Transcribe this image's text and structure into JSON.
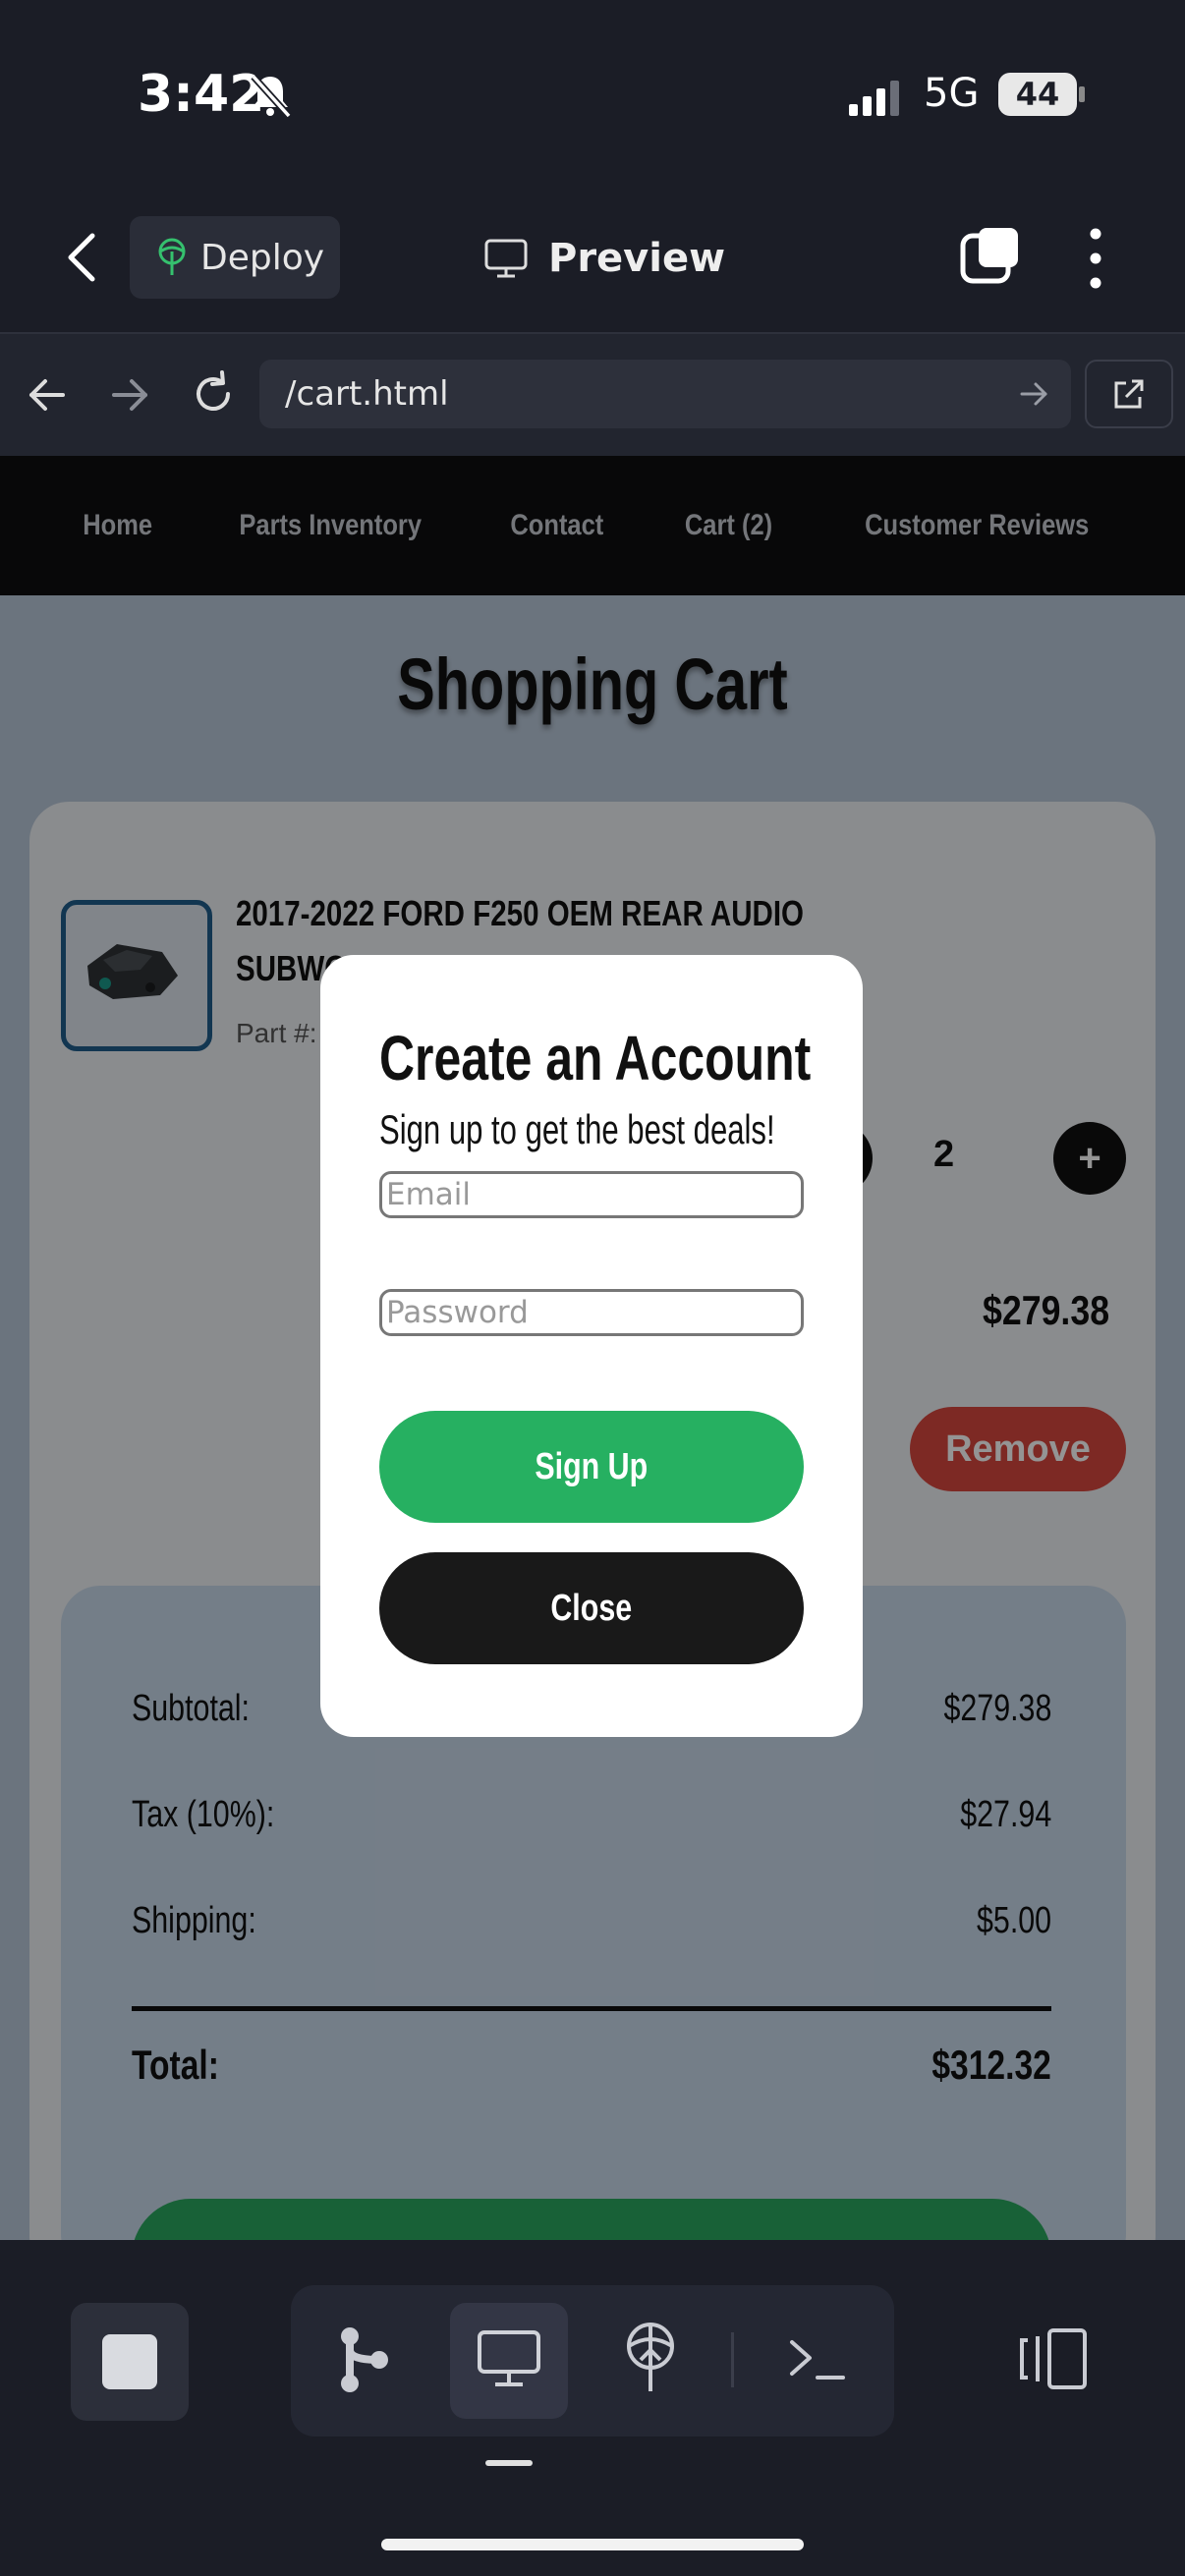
{
  "status_bar": {
    "time": "3:42",
    "network": "5G",
    "battery": "44"
  },
  "app_header": {
    "deploy_label": "Deploy",
    "preview_label": "Preview"
  },
  "browser": {
    "url": "/cart.html"
  },
  "site_nav": {
    "items": [
      "Home",
      "Parts Inventory",
      "Contact",
      "Cart (2)",
      "Customer Reviews"
    ]
  },
  "cart": {
    "title": "Shopping Cart",
    "item": {
      "name": "2017-2022 FORD F250 OEM REAR AUDIO SUBWOOFER SPEAKER BOX JL3Z18C...",
      "part_no": "Part #: ig",
      "quantity": "2",
      "price": "$279.38",
      "remove_label": "Remove",
      "plus_label": "+"
    },
    "summary": {
      "subtotal_label": "Subtotal:",
      "subtotal": "$279.38",
      "tax_label": "Tax (10%):",
      "tax": "$27.94",
      "shipping_label": "Shipping:",
      "shipping": "$5.00",
      "total_label": "Total:",
      "total": "$312.32"
    }
  },
  "modal": {
    "title": "Create an Account",
    "subtitle": "Sign up to get the best deals!",
    "email_placeholder": "Email",
    "password_placeholder": "Password",
    "signup_label": "Sign Up",
    "close_label": "Close"
  },
  "toolbar": {
    "icons": [
      "stop-icon",
      "branch-icon",
      "monitor-icon",
      "deploy-icon",
      "terminal-icon",
      "panel-toggle-icon"
    ]
  }
}
